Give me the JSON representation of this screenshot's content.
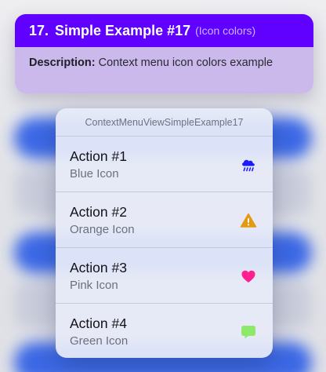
{
  "header": {
    "number": "17.",
    "title": "Simple Example #17",
    "subtitle": "(Icon colors)",
    "description_label": "Description:",
    "description_text": " Context menu icon colors example",
    "colors": {
      "title_bg": "#6000ff",
      "body_bg": "#cbb9ec"
    }
  },
  "menu": {
    "title": "ContextMenuViewSimpleExample17",
    "items": [
      {
        "title": "Action #1",
        "subtitle": "Blue Icon",
        "icon": "cloud-rain-icon",
        "icon_color": "#1a1aff"
      },
      {
        "title": "Action #2",
        "subtitle": "Orange Icon",
        "icon": "warning-triangle-icon",
        "icon_color": "#e39a12"
      },
      {
        "title": "Action #3",
        "subtitle": "Pink Icon",
        "icon": "heart-icon",
        "icon_color": "#ff1f8e"
      },
      {
        "title": "Action #4",
        "subtitle": "Green Icon",
        "icon": "message-bubble-icon",
        "icon_color": "#8ee86a"
      }
    ]
  }
}
